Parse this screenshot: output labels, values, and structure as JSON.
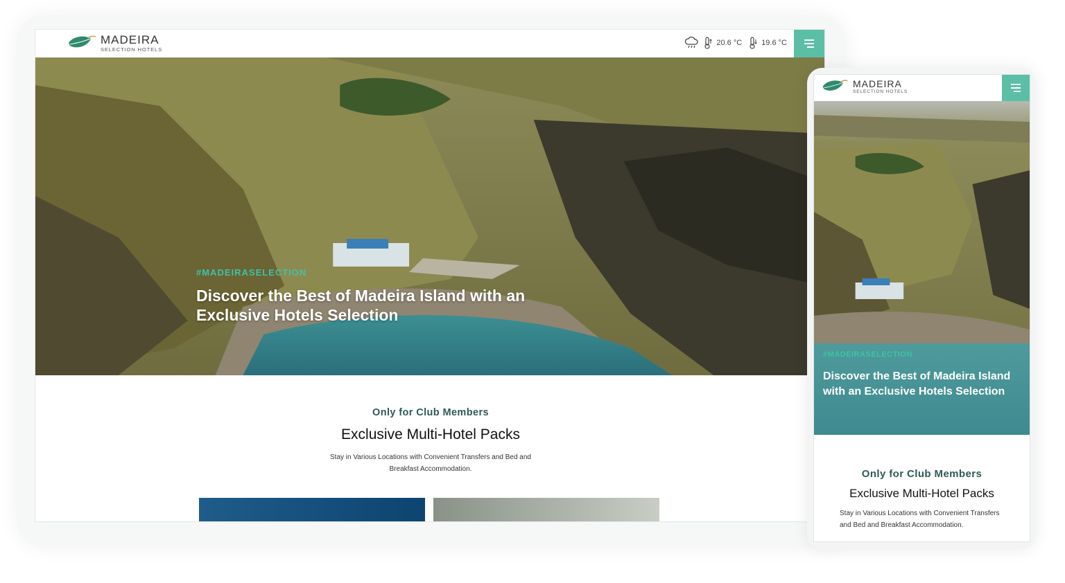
{
  "brand": {
    "name": "MADEIRA",
    "tagline": "SELECTION HOTELS"
  },
  "weather": {
    "icon": "cloud-rain-icon",
    "temp_high": "20.6 °C",
    "temp_low": "19.6 °C"
  },
  "hero": {
    "hashtag": "#MADEIRASELECTION",
    "title": "Discover the Best of Madeira Island with an Exclusive Hotels Selection"
  },
  "club": {
    "subtitle": "Only for Club Members",
    "title": "Exclusive Multi-Hotel Packs",
    "description": "Stay in Various Locations with Convenient Transfers and Bed and Breakfast Accommodation."
  },
  "colors": {
    "accent": "#5bbfa6",
    "hashtag": "#3fc3a3",
    "club_subtitle": "#2e5a55"
  }
}
